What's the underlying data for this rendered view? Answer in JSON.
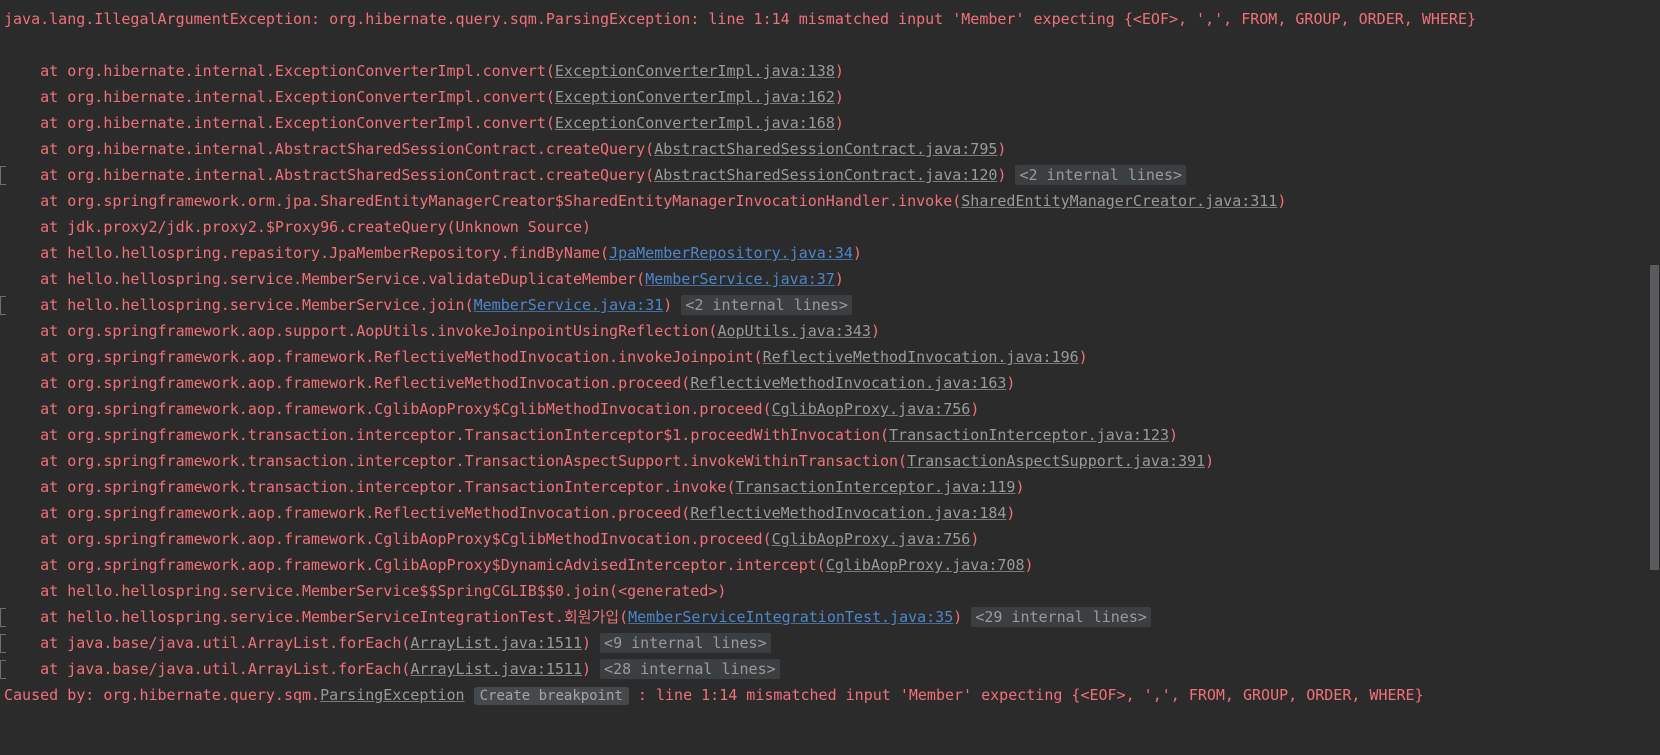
{
  "console": {
    "background_color": "#2b2b2b",
    "error_color": "#f07178",
    "library_link_color": "#9a9a9a",
    "project_link_color": "#4e86c9",
    "fold_badge_bg": "#3c3f41",
    "breakpoint_hint_bg": "#46494b",
    "scrollbar_thumb_color": "#595b5d",
    "header": "java.lang.IllegalArgumentException: org.hibernate.query.sqm.ParsingException: line 1:14 mismatched input 'Member' expecting {<EOF>, ',', FROM, GROUP, ORDER, WHERE}",
    "frames": [
      {
        "prefix": "    at org.hibernate.internal.ExceptionConverterImpl.convert(",
        "link": "ExceptionConverterImpl.java:138",
        "link_kind": "library",
        "suffix": ")",
        "fold": "",
        "marker": false
      },
      {
        "prefix": "    at org.hibernate.internal.ExceptionConverterImpl.convert(",
        "link": "ExceptionConverterImpl.java:162",
        "link_kind": "library",
        "suffix": ")",
        "fold": "",
        "marker": false
      },
      {
        "prefix": "    at org.hibernate.internal.ExceptionConverterImpl.convert(",
        "link": "ExceptionConverterImpl.java:168",
        "link_kind": "library",
        "suffix": ")",
        "fold": "",
        "marker": false
      },
      {
        "prefix": "    at org.hibernate.internal.AbstractSharedSessionContract.createQuery(",
        "link": "AbstractSharedSessionContract.java:795",
        "link_kind": "library",
        "suffix": ")",
        "fold": "",
        "marker": false
      },
      {
        "prefix": "    at org.hibernate.internal.AbstractSharedSessionContract.createQuery(",
        "link": "AbstractSharedSessionContract.java:120",
        "link_kind": "library",
        "suffix": ")",
        "fold": "<2 internal lines>",
        "marker": true
      },
      {
        "prefix": "    at org.springframework.orm.jpa.SharedEntityManagerCreator$SharedEntityManagerInvocationHandler.invoke(",
        "link": "SharedEntityManagerCreator.java:311",
        "link_kind": "library",
        "suffix": ")",
        "fold": "",
        "marker": false
      },
      {
        "prefix": "    at jdk.proxy2/jdk.proxy2.$Proxy96.createQuery(Unknown Source)",
        "link": "",
        "link_kind": "none",
        "suffix": "",
        "fold": "",
        "marker": false
      },
      {
        "prefix": "    at hello.hellospring.repasitory.JpaMemberRepository.findByName(",
        "link": "JpaMemberRepository.java:34",
        "link_kind": "project",
        "suffix": ")",
        "fold": "",
        "marker": false
      },
      {
        "prefix": "    at hello.hellospring.service.MemberService.validateDuplicateMember(",
        "link": "MemberService.java:37",
        "link_kind": "project",
        "suffix": ")",
        "fold": "",
        "marker": false
      },
      {
        "prefix": "    at hello.hellospring.service.MemberService.join(",
        "link": "MemberService.java:31",
        "link_kind": "project",
        "suffix": ")",
        "fold": "<2 internal lines>",
        "marker": true
      },
      {
        "prefix": "    at org.springframework.aop.support.AopUtils.invokeJoinpointUsingReflection(",
        "link": "AopUtils.java:343",
        "link_kind": "library",
        "suffix": ")",
        "fold": "",
        "marker": false
      },
      {
        "prefix": "    at org.springframework.aop.framework.ReflectiveMethodInvocation.invokeJoinpoint(",
        "link": "ReflectiveMethodInvocation.java:196",
        "link_kind": "library",
        "suffix": ")",
        "fold": "",
        "marker": false
      },
      {
        "prefix": "    at org.springframework.aop.framework.ReflectiveMethodInvocation.proceed(",
        "link": "ReflectiveMethodInvocation.java:163",
        "link_kind": "library",
        "suffix": ")",
        "fold": "",
        "marker": false
      },
      {
        "prefix": "    at org.springframework.aop.framework.CglibAopProxy$CglibMethodInvocation.proceed(",
        "link": "CglibAopProxy.java:756",
        "link_kind": "library",
        "suffix": ")",
        "fold": "",
        "marker": false
      },
      {
        "prefix": "    at org.springframework.transaction.interceptor.TransactionInterceptor$1.proceedWithInvocation(",
        "link": "TransactionInterceptor.java:123",
        "link_kind": "library",
        "suffix": ")",
        "fold": "",
        "marker": false
      },
      {
        "prefix": "    at org.springframework.transaction.interceptor.TransactionAspectSupport.invokeWithinTransaction(",
        "link": "TransactionAspectSupport.java:391",
        "link_kind": "library",
        "suffix": ")",
        "fold": "",
        "marker": false
      },
      {
        "prefix": "    at org.springframework.transaction.interceptor.TransactionInterceptor.invoke(",
        "link": "TransactionInterceptor.java:119",
        "link_kind": "library",
        "suffix": ")",
        "fold": "",
        "marker": false
      },
      {
        "prefix": "    at org.springframework.aop.framework.ReflectiveMethodInvocation.proceed(",
        "link": "ReflectiveMethodInvocation.java:184",
        "link_kind": "library",
        "suffix": ")",
        "fold": "",
        "marker": false
      },
      {
        "prefix": "    at org.springframework.aop.framework.CglibAopProxy$CglibMethodInvocation.proceed(",
        "link": "CglibAopProxy.java:756",
        "link_kind": "library",
        "suffix": ")",
        "fold": "",
        "marker": false
      },
      {
        "prefix": "    at org.springframework.aop.framework.CglibAopProxy$DynamicAdvisedInterceptor.intercept(",
        "link": "CglibAopProxy.java:708",
        "link_kind": "library",
        "suffix": ")",
        "fold": "",
        "marker": false
      },
      {
        "prefix": "    at hello.hellospring.service.MemberService$$SpringCGLIB$$0.join(<generated>)",
        "link": "",
        "link_kind": "none",
        "suffix": "",
        "fold": "",
        "marker": false
      },
      {
        "prefix": "    at hello.hellospring.service.MemberServiceIntegrationTest.회원가입(",
        "link": "MemberServiceIntegrationTest.java:35",
        "link_kind": "project",
        "suffix": ")",
        "fold": "<29 internal lines>",
        "marker": true
      },
      {
        "prefix": "    at java.base/java.util.ArrayList.forEach(",
        "link": "ArrayList.java:1511",
        "link_kind": "library",
        "suffix": ")",
        "fold": "<9 internal lines>",
        "marker": true
      },
      {
        "prefix": "    at java.base/java.util.ArrayList.forEach(",
        "link": "ArrayList.java:1511",
        "link_kind": "library",
        "suffix": ")",
        "fold": "<28 internal lines>",
        "marker": true
      }
    ],
    "caused_by": {
      "prefix": "Caused by: org.hibernate.query.sqm.",
      "link": "ParsingException",
      "link_kind": "library",
      "breakpoint_hint": "Create breakpoint",
      "suffix": " : line 1:14 mismatched input 'Member' expecting {<EOF>, ',', FROM, GROUP, ORDER, WHERE}"
    }
  }
}
